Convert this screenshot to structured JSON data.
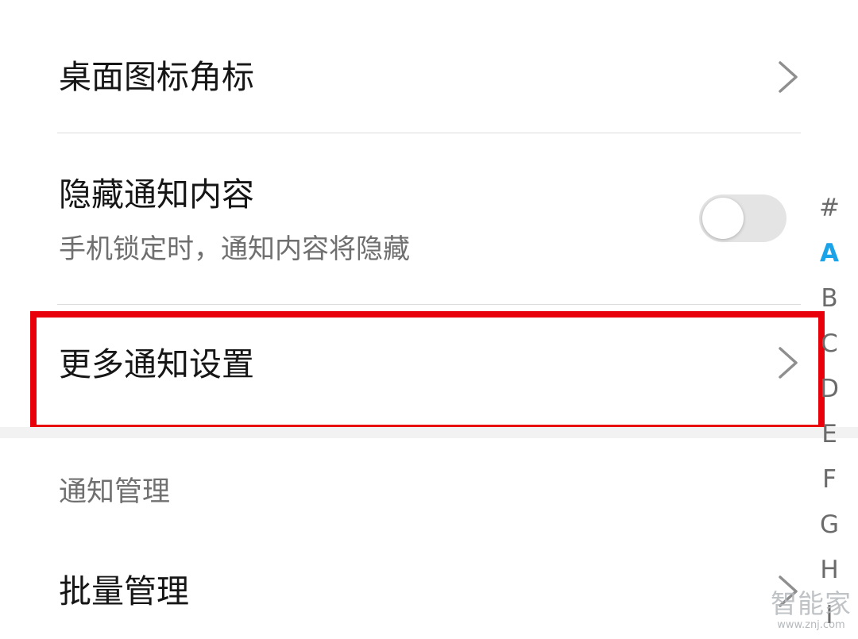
{
  "settings": {
    "badge_row": {
      "title": "桌面图标角标"
    },
    "hide_content_row": {
      "title": "隐藏通知内容",
      "subtitle": "手机锁定时，通知内容将隐藏",
      "toggle_on": false
    },
    "more_settings_row": {
      "title": "更多通知设置"
    }
  },
  "section_header": "通知管理",
  "batch_row": {
    "title": "批量管理"
  },
  "index_bar": {
    "letters": [
      "#",
      "A",
      "B",
      "C",
      "D",
      "E",
      "F",
      "G",
      "H",
      "I"
    ],
    "active": "A",
    "active_color": "#1aa3e8"
  },
  "colors": {
    "highlight_box": "#e8000b",
    "toggle_off_track": "#e4e4e4"
  },
  "watermark": {
    "logo": "智能家",
    "url": "www.znj.com"
  }
}
